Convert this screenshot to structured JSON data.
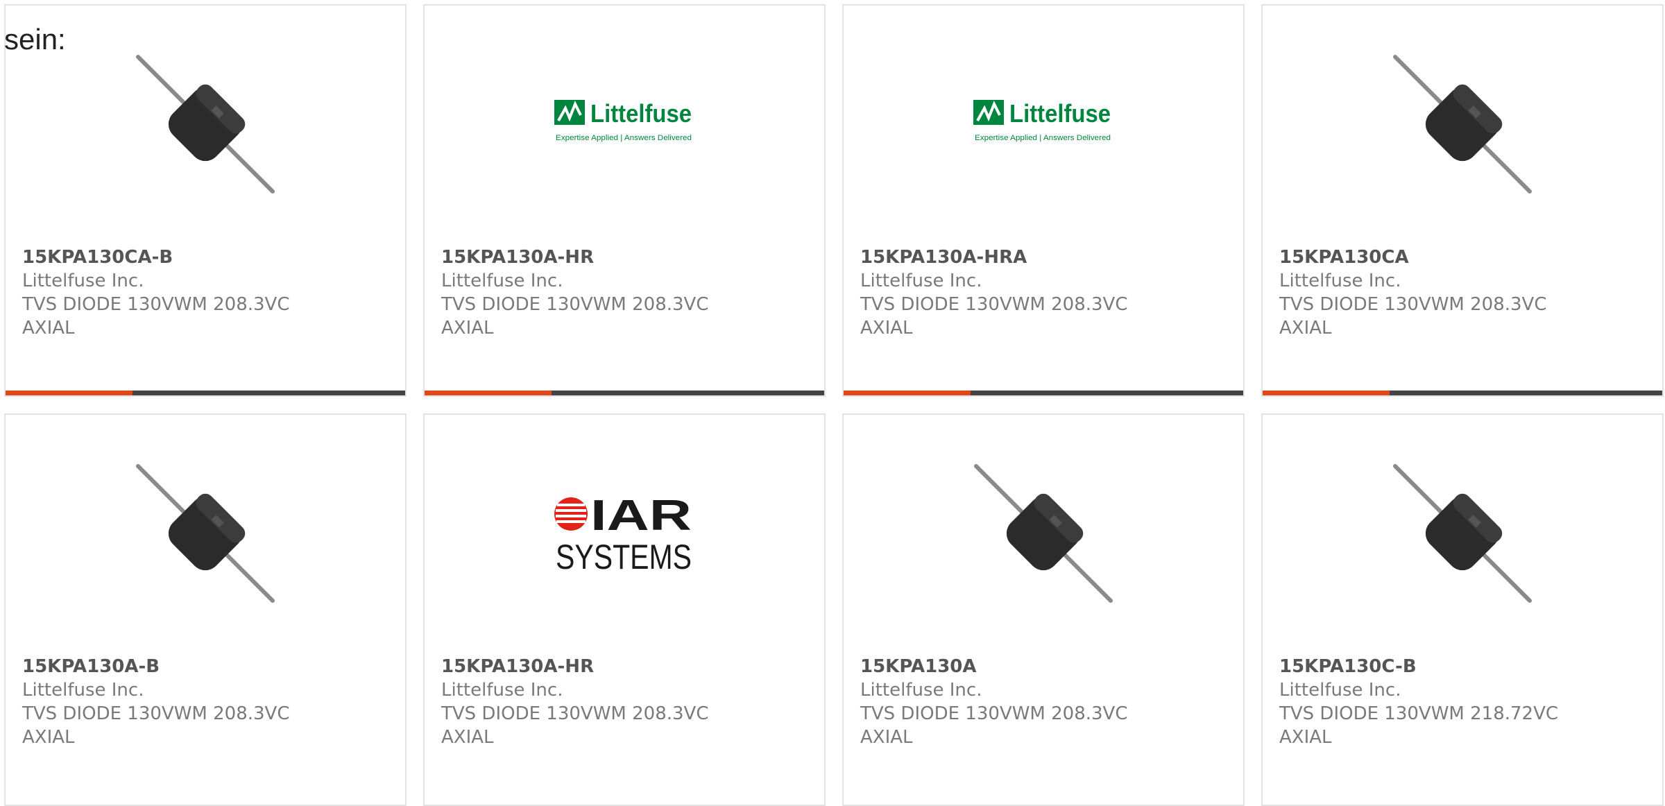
{
  "intro_text": "sein:",
  "colors": {
    "accent": "#e0481c",
    "bar": "#444444",
    "border": "#e3e3e3",
    "text": "#7a7a7a",
    "title": "#555555",
    "littelfuse_green": "#00853e",
    "iar_red": "#e2231a"
  },
  "products": [
    {
      "part_number": "15KPA130CA-B",
      "manufacturer": "Littelfuse Inc.",
      "desc_line1": "TVS DIODE 130VWM 208.3VC",
      "desc_line2": "AXIAL",
      "image": "diode-image"
    },
    {
      "part_number": "15KPA130A-HR",
      "manufacturer": "Littelfuse Inc.",
      "desc_line1": "TVS DIODE 130VWM 208.3VC",
      "desc_line2": "AXIAL",
      "image": "littelfuse-logo",
      "logo_name": "Littelfuse",
      "logo_tagline": "Expertise Applied | Answers Delivered"
    },
    {
      "part_number": "15KPA130A-HRA",
      "manufacturer": "Littelfuse Inc.",
      "desc_line1": "TVS DIODE 130VWM 208.3VC",
      "desc_line2": "AXIAL",
      "image": "littelfuse-logo",
      "logo_name": "Littelfuse",
      "logo_tagline": "Expertise Applied | Answers Delivered"
    },
    {
      "part_number": "15KPA130CA",
      "manufacturer": "Littelfuse Inc.",
      "desc_line1": "TVS DIODE 130VWM 208.3VC",
      "desc_line2": "AXIAL",
      "image": "diode-image"
    },
    {
      "part_number": "15KPA130A-B",
      "manufacturer": "Littelfuse Inc.",
      "desc_line1": "TVS DIODE 130VWM 208.3VC",
      "desc_line2": "AXIAL",
      "image": "diode-image"
    },
    {
      "part_number": "15KPA130A-HR",
      "manufacturer": "Littelfuse Inc.",
      "desc_line1": "TVS DIODE 130VWM 208.3VC",
      "desc_line2": "AXIAL",
      "image": "iar-systems-logo",
      "logo_name_line1": "IAR",
      "logo_name_line2": "SYSTEMS"
    },
    {
      "part_number": "15KPA130A",
      "manufacturer": "Littelfuse Inc.",
      "desc_line1": "TVS DIODE 130VWM 208.3VC",
      "desc_line2": "AXIAL",
      "image": "diode-image"
    },
    {
      "part_number": "15KPA130C-B",
      "manufacturer": "Littelfuse Inc.",
      "desc_line1": "TVS DIODE 130VWM 218.72VC",
      "desc_line2": "AXIAL",
      "image": "diode-image"
    }
  ]
}
